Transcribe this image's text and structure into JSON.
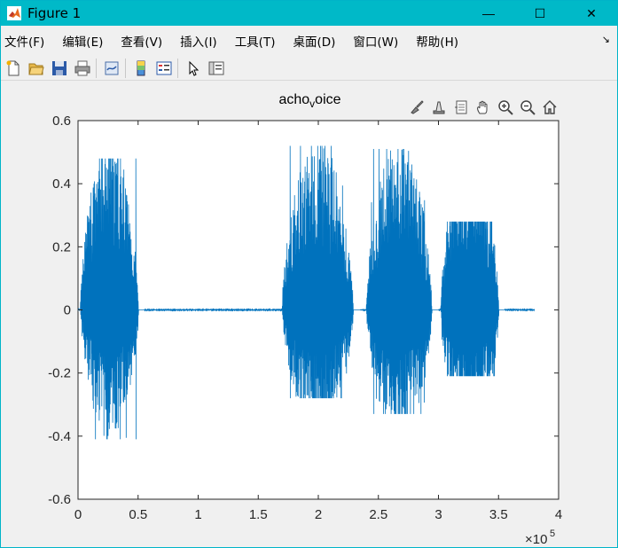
{
  "window": {
    "title": "Figure 1",
    "controls": [
      "—",
      "☐",
      "✕"
    ]
  },
  "menu": {
    "items": [
      "文件(F)",
      "编辑(E)",
      "查看(V)",
      "插入(I)",
      "工具(T)",
      "桌面(D)",
      "窗口(W)",
      "帮助(H)"
    ],
    "dock_glyph": "↘"
  },
  "toolbar": {
    "icons": [
      "new-figure-icon",
      "open-file-icon",
      "save-icon",
      "print-icon",
      "link-plot-icon",
      "colorbar-icon",
      "legend-icon",
      "edit-pointer-icon",
      "property-inspector-icon"
    ]
  },
  "axes_toolbar": {
    "icons": [
      "brush-icon",
      "data-tip-icon",
      "rotate-icon",
      "pan-icon",
      "zoom-in-icon",
      "zoom-out-icon",
      "home-icon"
    ]
  },
  "chart_data": {
    "type": "line",
    "title": "acho_voice",
    "title_main": "acho",
    "title_sub": "v",
    "title_rest": "oice",
    "xlabel": "",
    "ylabel": "",
    "xlim": [
      0,
      4
    ],
    "ylim": [
      -0.6,
      0.6
    ],
    "x_exponent_label": "×10",
    "x_exponent_power": "5",
    "x_ticks": [
      "0",
      "0.5",
      "1",
      "1.5",
      "2",
      "2.5",
      "3",
      "3.5",
      "4"
    ],
    "y_ticks": [
      "0.6",
      "0.4",
      "0.2",
      "0",
      "-0.2",
      "-0.4",
      "-0.6"
    ],
    "line_color": "#0072BD",
    "signal_end_x": 3.8,
    "bursts": [
      {
        "start": 0.02,
        "end": 0.55,
        "peak_pos": 0.48,
        "peak_neg": -0.41
      },
      {
        "start": 1.7,
        "end": 2.35,
        "peak_pos": 0.52,
        "peak_neg": -0.28
      },
      {
        "start": 2.4,
        "end": 3.0,
        "peak_pos": 0.51,
        "peak_neg": -0.33
      },
      {
        "start": 3.02,
        "end": 3.55,
        "peak_pos": 0.28,
        "peak_neg": -0.21
      }
    ]
  }
}
